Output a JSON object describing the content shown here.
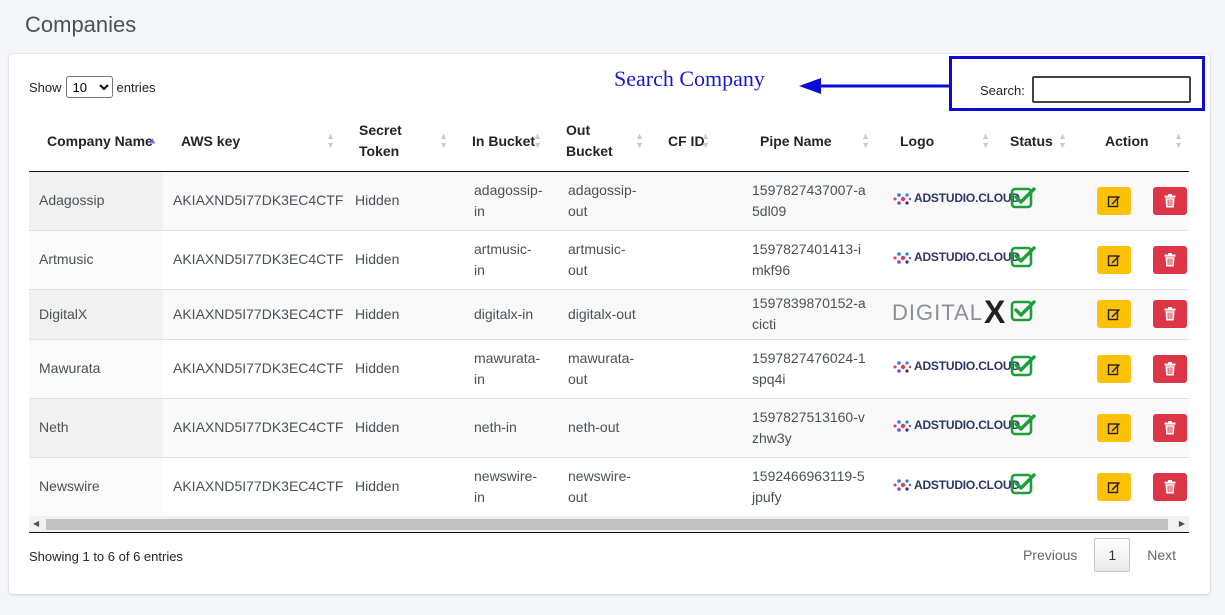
{
  "page": {
    "title": "Companies"
  },
  "length": {
    "show_label": "Show",
    "selected": "10",
    "entries_label": "entries"
  },
  "annotation": {
    "text": "Search Company"
  },
  "search": {
    "label": "Search:",
    "value": "",
    "placeholder": ""
  },
  "table": {
    "headers": [
      "Company Name",
      "AWS key",
      "Secret Token",
      "In Bucket",
      "Out Bucket",
      "CF ID",
      "Pipe Name",
      "Logo",
      "Status",
      "Action"
    ],
    "sorted_column": "Company Name",
    "rows": [
      {
        "name": "Adagossip",
        "aws_key": "AKIAXND5I77DK3EC4CTF",
        "secret": "Hidden",
        "in_bucket": "adagossip-in",
        "out_bucket": "adagossip-out",
        "cf_id": "",
        "pipe": "1597827437007-a5dl09",
        "logo": "ADSTUDIO.CLOUD",
        "status": "active"
      },
      {
        "name": "Artmusic",
        "aws_key": "AKIAXND5I77DK3EC4CTF",
        "secret": "Hidden",
        "in_bucket": "artmusic-in",
        "out_bucket": "artmusic-out",
        "cf_id": "",
        "pipe": "1597827401413-imkf96",
        "logo": "ADSTUDIO.CLOUD",
        "status": "active"
      },
      {
        "name": "DigitalX",
        "aws_key": "AKIAXND5I77DK3EC4CTF",
        "secret": "Hidden",
        "in_bucket": "digitalx-in",
        "out_bucket": "digitalx-out",
        "cf_id": "",
        "pipe": "1597839870152-acicti",
        "logo": "DIGITALX",
        "status": "active"
      },
      {
        "name": "Mawurata",
        "aws_key": "AKIAXND5I77DK3EC4CTF",
        "secret": "Hidden",
        "in_bucket": "mawurata-in",
        "out_bucket": "mawurata-out",
        "cf_id": "",
        "pipe": "1597827476024-1spq4i",
        "logo": "ADSTUDIO.CLOUD",
        "status": "active"
      },
      {
        "name": "Neth",
        "aws_key": "AKIAXND5I77DK3EC4CTF",
        "secret": "Hidden",
        "in_bucket": "neth-in",
        "out_bucket": "neth-out",
        "cf_id": "",
        "pipe": "1597827513160-vzhw3y",
        "logo": "ADSTUDIO.CLOUD",
        "status": "active"
      },
      {
        "name": "Newswire",
        "aws_key": "AKIAXND5I77DK3EC4CTF",
        "secret": "Hidden",
        "in_bucket": "newswire-in",
        "out_bucket": "newswire-out",
        "cf_id": "",
        "pipe": "1592466963119-5jpufy",
        "logo": "ADSTUDIO.CLOUD",
        "status": "active"
      }
    ]
  },
  "footer": {
    "info": "Showing 1 to 6 of 6 entries",
    "previous": "Previous",
    "current_page": "1",
    "next": "Next"
  },
  "colors": {
    "edit_button": "#ffc107",
    "delete_button": "#dc3545",
    "status_check": "#1e9e3a",
    "annotation": "#0b0bd6"
  },
  "icons": {
    "status": "check-square-icon",
    "edit": "edit-icon",
    "delete": "trash-icon"
  }
}
